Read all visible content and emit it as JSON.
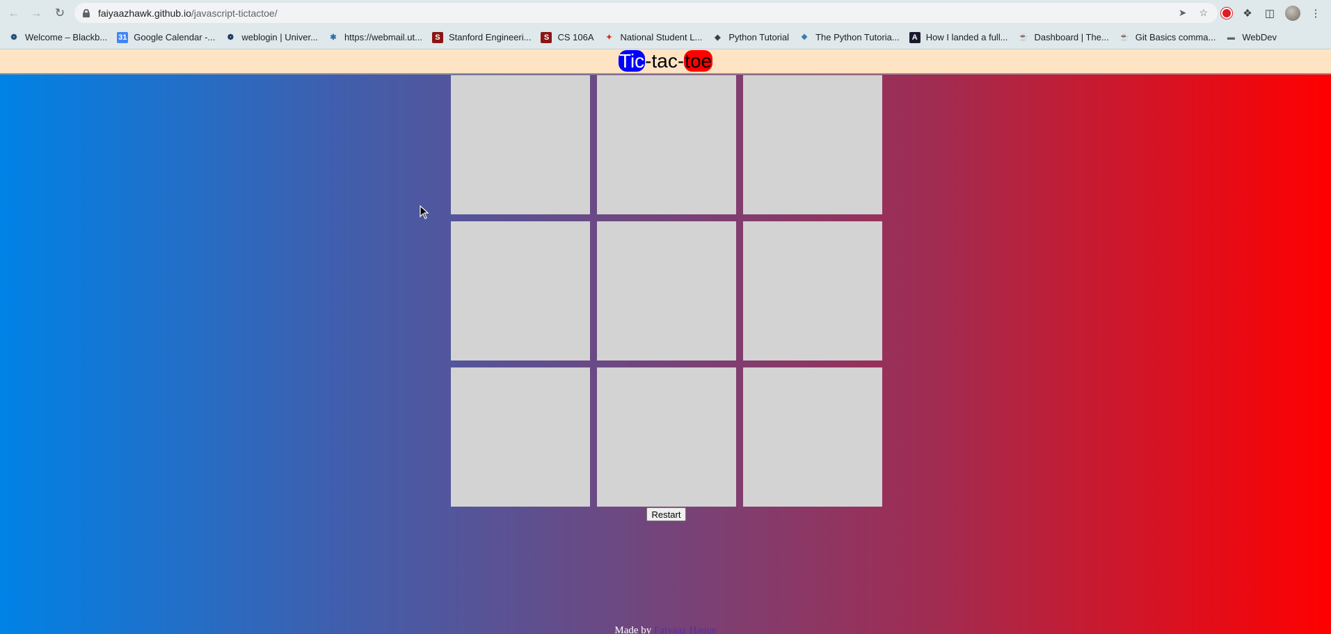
{
  "browser": {
    "url_host": "faiyaazhawk.github.io",
    "url_path": "/javascript-tictactoe/",
    "bookmarks": [
      {
        "label": "Welcome – Blackb...",
        "icon": "blackboard-icon"
      },
      {
        "label": "Google Calendar -...",
        "icon": "google-calendar-icon"
      },
      {
        "label": "weblogin | Univer...",
        "icon": "university-icon"
      },
      {
        "label": "https://webmail.ut...",
        "icon": "webmail-icon"
      },
      {
        "label": "Stanford Engineeri...",
        "icon": "stanford-icon"
      },
      {
        "label": "CS 106A",
        "icon": "stanford-icon"
      },
      {
        "label": "National Student L...",
        "icon": "maple-leaf-icon"
      },
      {
        "label": "Python Tutorial",
        "icon": "python-tutorial-icon"
      },
      {
        "label": "The Python Tutoria...",
        "icon": "python-icon"
      },
      {
        "label": "How I landed a full...",
        "icon": "medium-icon"
      },
      {
        "label": "Dashboard | The...",
        "icon": "odin-icon"
      },
      {
        "label": "Git Basics comma...",
        "icon": "odin-icon"
      },
      {
        "label": "WebDev",
        "icon": "folder-icon"
      }
    ]
  },
  "page": {
    "title_part1": "Tic",
    "title_sep1": "-tac-",
    "title_part3": "toe",
    "restart_label": "Restart",
    "footer_prefix": "Made by ",
    "footer_author": "Faiyaaz Haque",
    "cells": [
      "",
      "",
      "",
      "",
      "",
      "",
      "",
      "",
      ""
    ],
    "colors": {
      "gradient_left": "#0082e6",
      "gradient_right": "#ff0000",
      "header_bg": "#ffe4c4",
      "cell_bg": "#d3d3d3",
      "tic_bg": "#0000ff",
      "toe_bg": "#ff0000"
    }
  }
}
